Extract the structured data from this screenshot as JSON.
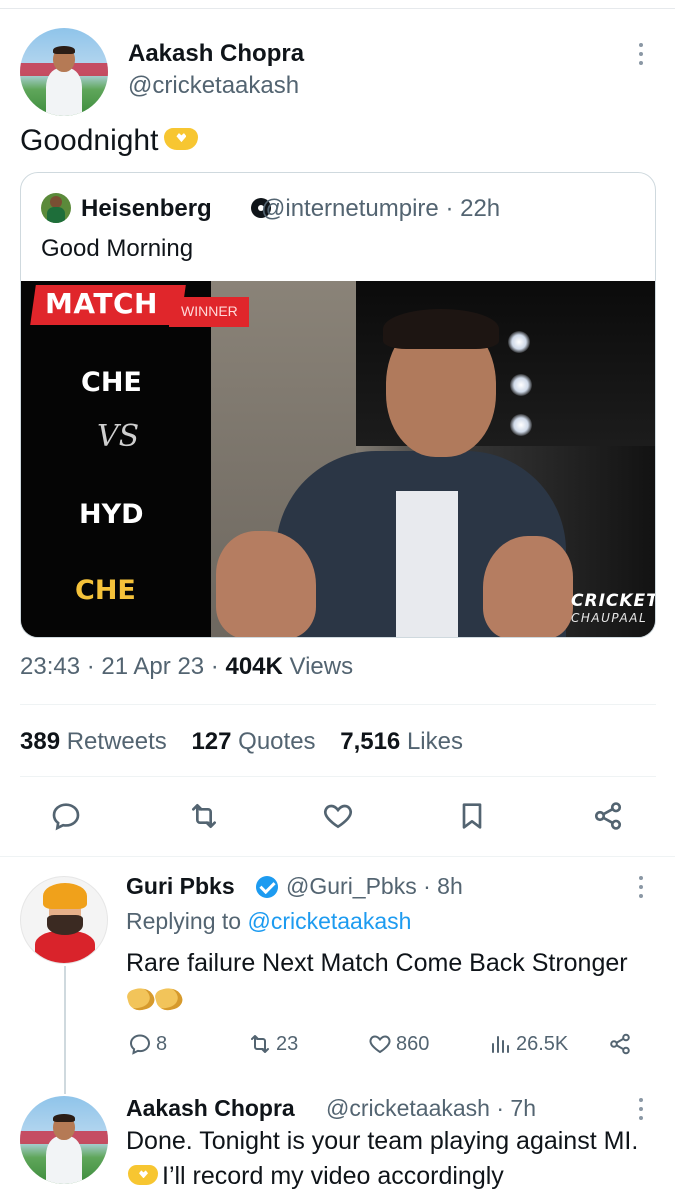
{
  "main_tweet": {
    "author_name": "Aakash Chopra",
    "author_handle": "@cricketaakash",
    "text": "Goodnight",
    "timestamp": "23:43 · 21 Apr 23 · ",
    "views_count": "404K",
    "views_label": " Views",
    "stats": {
      "retweets_count": "389",
      "retweets_label": "Retweets",
      "quotes_count": "127",
      "quotes_label": "Quotes",
      "likes_count": "7,516",
      "likes_label": "Likes"
    }
  },
  "quoted_tweet": {
    "author_name": "Heisenberg",
    "author_handle": "@internetumpire · 22h",
    "text": "Good Morning",
    "media": {
      "banner_title": "MATCH",
      "banner_subtitle": "WINNER",
      "team1": "CHE",
      "vs_label": "VS",
      "team2": "HYD",
      "winner": "CHE",
      "logo_line1": "CRICKET",
      "logo_line2": "CHAUPAAL"
    }
  },
  "replies": [
    {
      "author_name": "Guri Pbks",
      "author_handle": "@Guri_Pbks · 8h",
      "replying_prefix": "Replying to ",
      "replying_to": "@cricketaakash",
      "text": "Rare failure Next Match Come Back Stronger",
      "reply_count": "8",
      "retweet_count": "23",
      "like_count": "860",
      "view_count": "26.5K"
    },
    {
      "author_name": "Aakash Chopra",
      "author_handle": "@cricketaakash · 7h",
      "text_before": "Done. Tonight is your team playing against MI.",
      "text_after": "I’ll record my video accordingly"
    }
  ],
  "colors": {
    "accent": "#1d9bf0",
    "secondary_text": "#536471",
    "primary_text": "#0f1419",
    "banner_red": "#e0262b",
    "winner_gold": "#f5c23a"
  },
  "icons": [
    "more-icon",
    "radioactive-icon",
    "reply-icon",
    "retweet-icon",
    "like-icon",
    "bookmark-icon",
    "share-icon",
    "views-icon",
    "verified-badge-icon",
    "heart-hands-emoji",
    "clapping-hands-emoji"
  ]
}
